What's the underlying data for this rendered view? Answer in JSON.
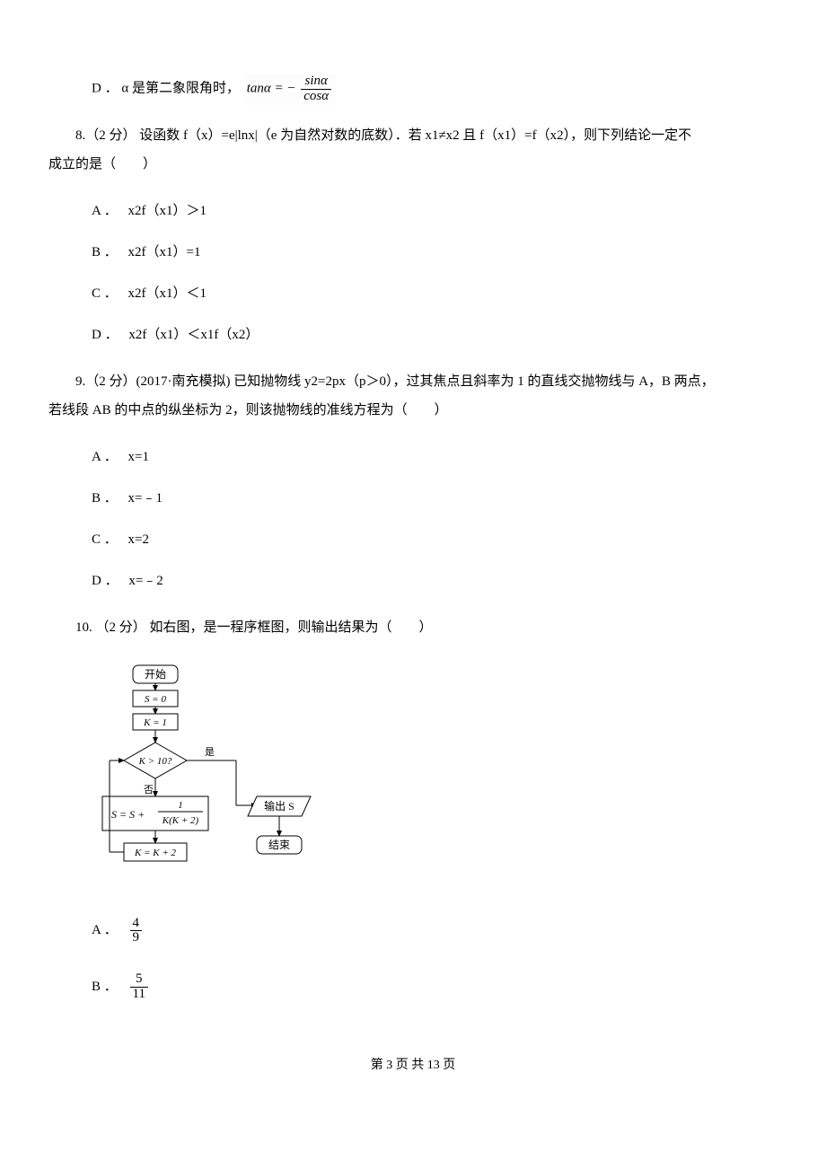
{
  "q7": {
    "D": {
      "prefix": "D ．",
      "text": "α 是第二象限角时，",
      "formula_lhs": "tanα = − ",
      "formula_num": "sinα",
      "formula_den": "cosα"
    }
  },
  "q8": {
    "stem_a": "8.（2 分） 设函数 f（x）=e|lnx|（e 为自然对数的底数）．若 x1≠x2 且 f（x1）=f（x2），则下列结论一定不",
    "stem_b": "成立的是（　　）",
    "A": {
      "prefix": "A ．",
      "text": "x2f（x1）＞1"
    },
    "B": {
      "prefix": "B ．",
      "text": "x2f（x1）=1"
    },
    "C": {
      "prefix": "C ．",
      "text": "x2f（x1）＜1"
    },
    "D": {
      "prefix": "D ．",
      "text": "x2f（x1）＜x1f（x2）"
    }
  },
  "q9": {
    "stem_a": "9.（2 分）(2017·南充模拟) 已知抛物线 y2=2px（p＞0），过其焦点且斜率为 1 的直线交抛物线与 A，B 两点，",
    "stem_b": "若线段 AB 的中点的纵坐标为 2，则该抛物线的准线方程为（　　）",
    "A": {
      "prefix": "A ．",
      "text": "x=1"
    },
    "B": {
      "prefix": "B ．",
      "text": "x=﹣1"
    },
    "C": {
      "prefix": "C ．",
      "text": "x=2"
    },
    "D": {
      "prefix": "D ．",
      "text": "x=﹣2"
    }
  },
  "q10": {
    "stem": "10. （2 分） 如右图，是一程序框图，则输出结果为（　　）",
    "A": {
      "prefix": "A ．",
      "num": "4",
      "den": "9"
    },
    "B": {
      "prefix": "B ．",
      "num": "5",
      "den": "11"
    }
  },
  "chart_data": {
    "type": "flowchart",
    "nodes": [
      {
        "id": "start",
        "label": "开始",
        "shape": "terminator"
      },
      {
        "id": "s0",
        "label": "S = 0",
        "shape": "process"
      },
      {
        "id": "k1",
        "label": "K = 1",
        "shape": "process"
      },
      {
        "id": "cond",
        "label": "K > 10?",
        "shape": "decision"
      },
      {
        "id": "upd",
        "label": "S = S + 1 / (K(K+2))",
        "shape": "process"
      },
      {
        "id": "inc",
        "label": "K = K + 2",
        "shape": "process"
      },
      {
        "id": "out",
        "label": "输出 S",
        "shape": "io"
      },
      {
        "id": "end",
        "label": "结束",
        "shape": "terminator"
      }
    ],
    "edges": [
      {
        "from": "start",
        "to": "s0"
      },
      {
        "from": "s0",
        "to": "k1"
      },
      {
        "from": "k1",
        "to": "cond"
      },
      {
        "from": "cond",
        "to": "out",
        "label": "是"
      },
      {
        "from": "cond",
        "to": "upd",
        "label": "否"
      },
      {
        "from": "upd",
        "to": "inc"
      },
      {
        "from": "inc",
        "to": "cond"
      },
      {
        "from": "out",
        "to": "end"
      }
    ]
  },
  "flow": {
    "start": "开始",
    "s0": "S = 0",
    "k1": "K = 1",
    "cond": "K > 10?",
    "yes": "是",
    "no": "否",
    "upd_lhs": "S = S + ",
    "upd_num": "1",
    "upd_den": "K(K + 2)",
    "inc": "K = K + 2",
    "out": "输出 S",
    "end": "结束"
  },
  "footer": "第 3 页 共 13 页"
}
